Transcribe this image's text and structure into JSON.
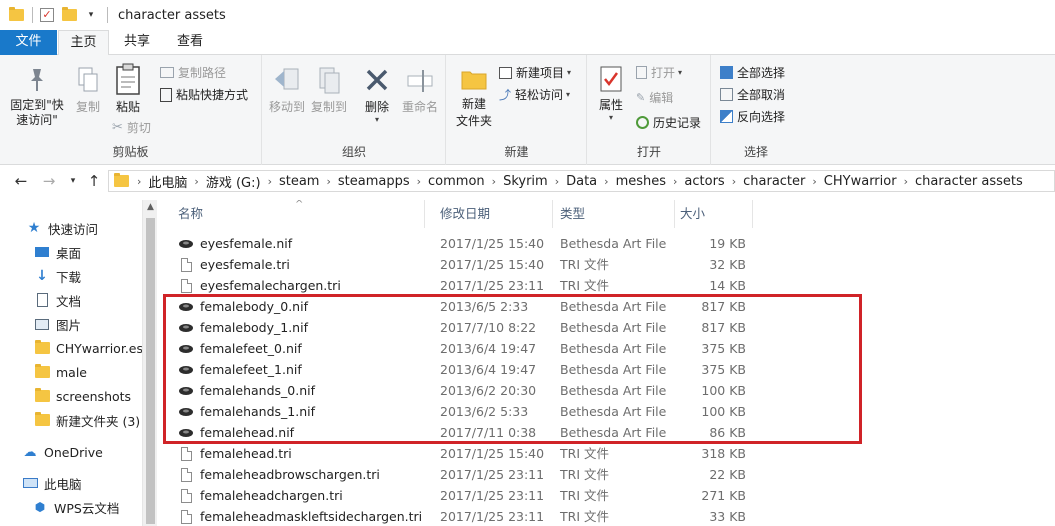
{
  "window": {
    "title": "character assets"
  },
  "ribbon_tabs": {
    "file": "文件",
    "home": "主页",
    "share": "共享",
    "view": "查看"
  },
  "ribbon": {
    "clipboard": {
      "group": "剪贴板",
      "pin": "固定到\"快\n速访问\"",
      "copy": "复制",
      "paste": "粘贴",
      "copy_path": "复制路径",
      "paste_shortcut": "粘贴快捷方式",
      "cut": "剪切"
    },
    "organize": {
      "group": "组织",
      "move_to": "移动到",
      "copy_to": "复制到",
      "delete": "删除",
      "rename": "重命名"
    },
    "new": {
      "group": "新建",
      "new_folder": "新建\n文件夹",
      "new_item": "新建项目",
      "easy_access": "轻松访问"
    },
    "open": {
      "group": "打开",
      "properties": "属性",
      "open": "打开",
      "edit": "编辑",
      "history": "历史记录"
    },
    "select": {
      "group": "选择",
      "select_all": "全部选择",
      "select_none": "全部取消",
      "invert": "反向选择"
    }
  },
  "breadcrumb": [
    "此电脑",
    "游戏 (G:)",
    "steam",
    "steamapps",
    "common",
    "Skyrim",
    "Data",
    "meshes",
    "actors",
    "character",
    "CHYwarrior",
    "character assets"
  ],
  "nav_pane": {
    "quick_access": "快速访问",
    "items": [
      {
        "label": "桌面",
        "icon": "desktop-icon",
        "pinned": true
      },
      {
        "label": "下载",
        "icon": "download-icon",
        "pinned": true
      },
      {
        "label": "文档",
        "icon": "documents-icon",
        "pinned": true
      },
      {
        "label": "图片",
        "icon": "pictures-icon",
        "pinned": true
      },
      {
        "label": "CHYwarrior.esp",
        "icon": "folder-icon",
        "pinned": false
      },
      {
        "label": "male",
        "icon": "folder-icon",
        "pinned": false
      },
      {
        "label": "screenshots",
        "icon": "folder-icon",
        "pinned": false
      },
      {
        "label": "新建文件夹 (3)",
        "icon": "folder-icon",
        "pinned": false
      }
    ],
    "onedrive": "OneDrive",
    "this_pc": "此电脑",
    "wps": "WPS云文档"
  },
  "columns": {
    "name": "名称",
    "modified": "修改日期",
    "type": "类型",
    "size": "大小"
  },
  "files": [
    {
      "name": "eyesfemale.nif",
      "date": "2017/1/25 15:40",
      "type": "Bethesda Art File",
      "size": "19 KB",
      "kind": "nif"
    },
    {
      "name": "eyesfemale.tri",
      "date": "2017/1/25 15:40",
      "type": "TRI 文件",
      "size": "32 KB",
      "kind": "tri"
    },
    {
      "name": "eyesfemalechargen.tri",
      "date": "2017/1/25 23:11",
      "type": "TRI 文件",
      "size": "14 KB",
      "kind": "tri"
    },
    {
      "name": "femalebody_0.nif",
      "date": "2013/6/5 2:33",
      "type": "Bethesda Art File",
      "size": "817 KB",
      "kind": "nif"
    },
    {
      "name": "femalebody_1.nif",
      "date": "2017/7/10 8:22",
      "type": "Bethesda Art File",
      "size": "817 KB",
      "kind": "nif"
    },
    {
      "name": "femalefeet_0.nif",
      "date": "2013/6/4 19:47",
      "type": "Bethesda Art File",
      "size": "375 KB",
      "kind": "nif"
    },
    {
      "name": "femalefeet_1.nif",
      "date": "2013/6/4 19:47",
      "type": "Bethesda Art File",
      "size": "375 KB",
      "kind": "nif"
    },
    {
      "name": "femalehands_0.nif",
      "date": "2013/6/2 20:30",
      "type": "Bethesda Art File",
      "size": "100 KB",
      "kind": "nif"
    },
    {
      "name": "femalehands_1.nif",
      "date": "2013/6/2 5:33",
      "type": "Bethesda Art File",
      "size": "100 KB",
      "kind": "nif"
    },
    {
      "name": "femalehead.nif",
      "date": "2017/7/11 0:38",
      "type": "Bethesda Art File",
      "size": "86 KB",
      "kind": "nif"
    },
    {
      "name": "femalehead.tri",
      "date": "2017/1/25 15:40",
      "type": "TRI 文件",
      "size": "318 KB",
      "kind": "tri"
    },
    {
      "name": "femaleheadbrowschargen.tri",
      "date": "2017/1/25 23:11",
      "type": "TRI 文件",
      "size": "22 KB",
      "kind": "tri"
    },
    {
      "name": "femaleheadchargen.tri",
      "date": "2017/1/25 23:11",
      "type": "TRI 文件",
      "size": "271 KB",
      "kind": "tri"
    },
    {
      "name": "femaleheadmaskleftsidechargen.tri",
      "date": "2017/1/25 23:11",
      "type": "TRI 文件",
      "size": "33 KB",
      "kind": "tri"
    }
  ],
  "colors": {
    "accent": "#1979ca",
    "highlight_box": "#d02328",
    "folder": "#f5c542"
  }
}
